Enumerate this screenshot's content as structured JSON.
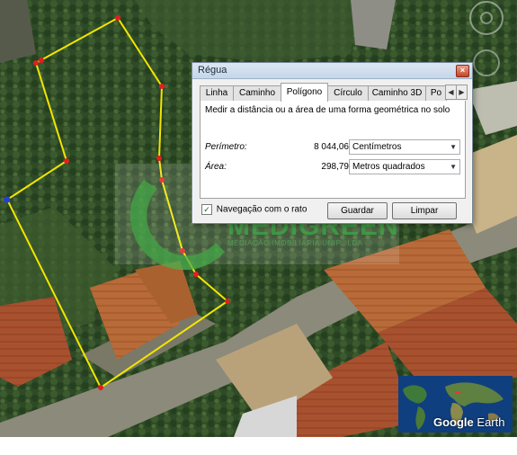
{
  "window": {
    "title": "Régua",
    "close_symbol": "×"
  },
  "tabs": [
    {
      "label": "Linha",
      "active": false
    },
    {
      "label": "Caminho",
      "active": false
    },
    {
      "label": "Polígono",
      "active": true
    },
    {
      "label": "Círculo",
      "active": false
    },
    {
      "label": "Caminho 3D",
      "active": false
    },
    {
      "label": "Po",
      "active": false
    }
  ],
  "tab_scroll": {
    "left": "◀",
    "right": "▶"
  },
  "panel": {
    "description": "Medir a distância ou a área de uma forma geométrica no solo",
    "perimeter": {
      "label": "Perímetro:",
      "value": "8 044,06",
      "unit": "Centímetros"
    },
    "area": {
      "label": "Área:",
      "value": "298,79",
      "unit": "Metros quadrados"
    },
    "dropdown_arrow": "▼"
  },
  "footer": {
    "checkbox_label": "Navegação com o rato",
    "checkbox_checked": true,
    "check_mark": "✓",
    "save_label": "Guardar",
    "clear_label": "Limpar"
  },
  "watermark": {
    "name": "MEDIGREEN",
    "tagline": "MEDIAÇÃO IMOBILIÁRIA UNIP., LDA"
  },
  "overview": {
    "brand": "Google",
    "brand_suffix": "Earth"
  },
  "colors": {
    "polygon_line": "#f2e600",
    "vertex": "#e02020",
    "vertex_selected": "#2040e0"
  }
}
